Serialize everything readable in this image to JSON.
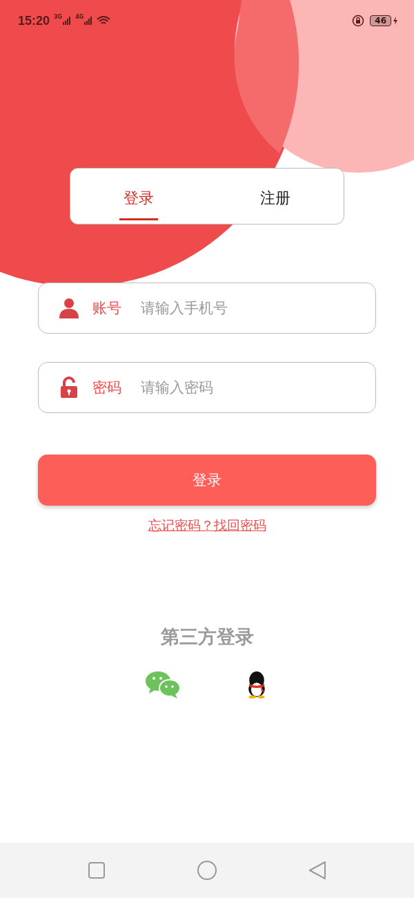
{
  "status_bar": {
    "time": "15:20",
    "network_1": "3G",
    "network_2": "4G",
    "battery": "46"
  },
  "tabs": [
    {
      "label": "登录",
      "selected": true
    },
    {
      "label": "注册",
      "selected": false
    }
  ],
  "fields": [
    {
      "kind": "account",
      "label": "账号",
      "placeholder": "请输入手机号"
    },
    {
      "kind": "password",
      "label": "密码",
      "placeholder": "请输入密码"
    }
  ],
  "login_button": "登录",
  "forgot_link": "忘记密码？找回密码",
  "third_party": {
    "title": "第三方登录",
    "options": [
      {
        "kind": "chat"
      },
      {
        "kind": "penguin"
      }
    ]
  },
  "nav_bar": {
    "buttons": [
      {
        "kind": "square"
      },
      {
        "kind": "circle"
      },
      {
        "kind": "back"
      }
    ]
  }
}
